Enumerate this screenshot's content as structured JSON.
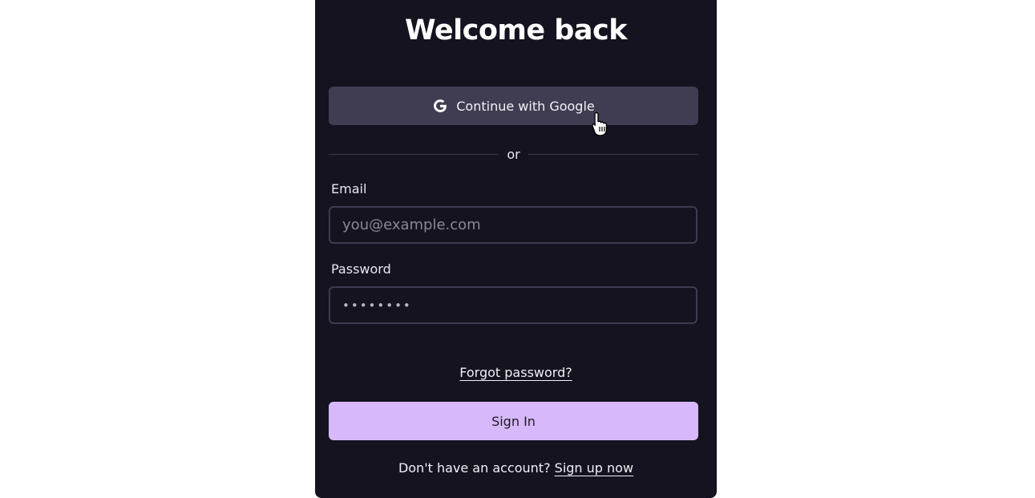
{
  "login": {
    "title": "Welcome back",
    "google_button_label": "Continue with Google",
    "divider_text": "or",
    "email_label": "Email",
    "email_placeholder": "you@example.com",
    "email_value": "",
    "password_label": "Password",
    "password_masked": "••••••••",
    "forgot_password_link": "Forgot password?",
    "sign_in_button_label": "Sign In",
    "no_account_text": "Don't have an account?",
    "sign_up_link": "Sign up now"
  },
  "icons": {
    "google": "google-icon",
    "cursor": "hand-pointer-cursor"
  },
  "colors": {
    "card_background": "#14131f",
    "google_button": "#403d53",
    "primary_button": "#d7b8fb",
    "input_border": "#3d3a50"
  }
}
